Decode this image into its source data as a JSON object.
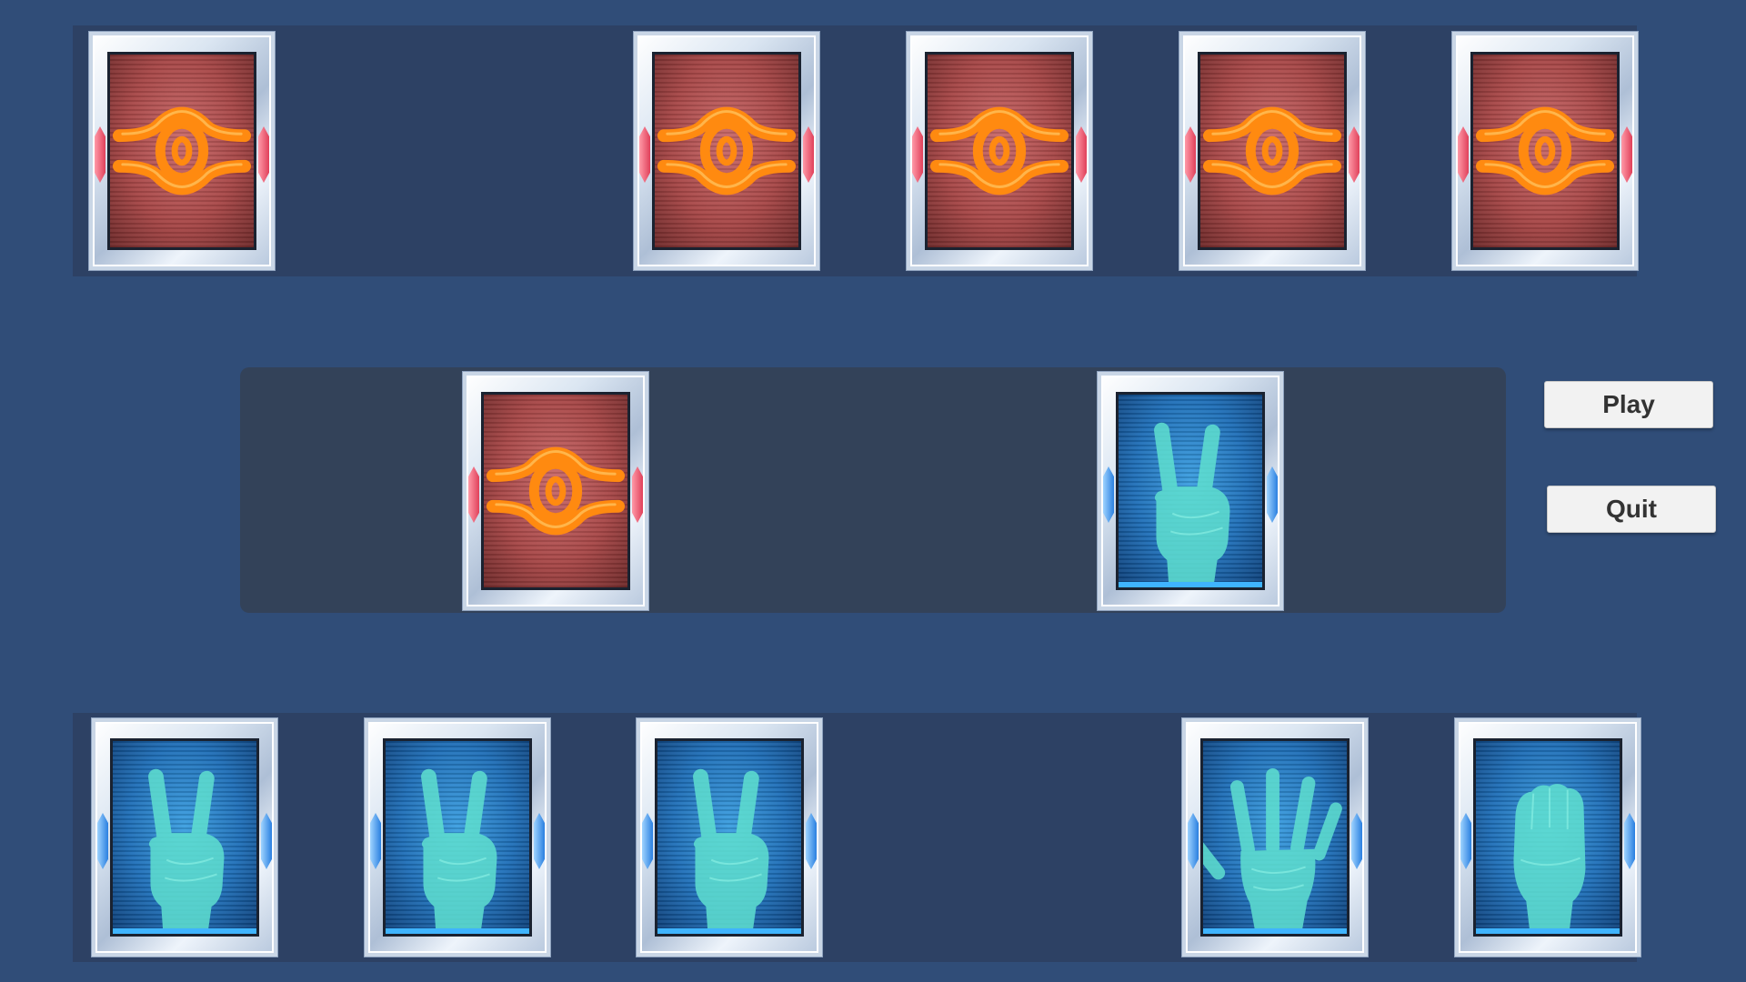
{
  "menu": {
    "play_label": "Play",
    "quit_label": "Quit"
  },
  "colors": {
    "background": "#304d78",
    "strip": "#2d4164",
    "table_panel": "#334259",
    "card_back": "#a84848",
    "card_emblem": "#ff8a10",
    "card_hand": "#1f6fb8",
    "hand_glow": "#5fe0d0"
  },
  "opponent_hand": {
    "cards": [
      {
        "face": "back",
        "icon": "eye-emblem-icon"
      },
      {
        "face": "empty"
      },
      {
        "face": "back",
        "icon": "eye-emblem-icon"
      },
      {
        "face": "back",
        "icon": "eye-emblem-icon"
      },
      {
        "face": "back",
        "icon": "eye-emblem-icon"
      },
      {
        "face": "back",
        "icon": "eye-emblem-icon"
      }
    ]
  },
  "play_area": {
    "opponent_card": {
      "face": "back",
      "icon": "eye-emblem-icon"
    },
    "player_card": {
      "face": "scissors",
      "icon": "scissors-hand-icon"
    }
  },
  "player_hand": {
    "cards": [
      {
        "face": "scissors",
        "icon": "scissors-hand-icon"
      },
      {
        "face": "scissors",
        "icon": "scissors-hand-icon"
      },
      {
        "face": "scissors",
        "icon": "scissors-hand-icon"
      },
      {
        "face": "empty"
      },
      {
        "face": "paper",
        "icon": "paper-hand-icon"
      },
      {
        "face": "rock",
        "icon": "rock-hand-icon"
      }
    ]
  }
}
